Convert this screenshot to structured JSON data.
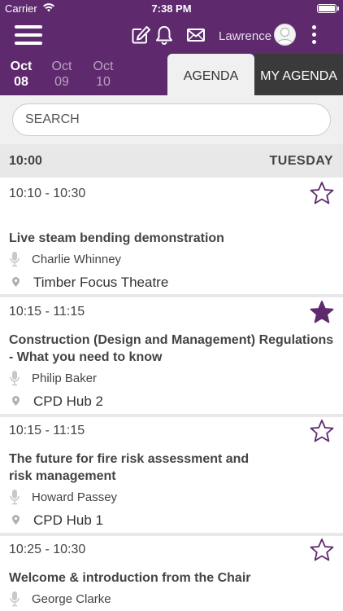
{
  "status_bar": {
    "carrier": "Carrier",
    "time": "7:38 PM"
  },
  "header": {
    "user_name": "Lawrence"
  },
  "dates": [
    {
      "month": "Oct",
      "day": "08",
      "active": true
    },
    {
      "month": "Oct",
      "day": "09",
      "active": false
    },
    {
      "month": "Oct",
      "day": "10",
      "active": false
    }
  ],
  "tabs": {
    "agenda": "AGENDA",
    "my_agenda": "MY AGENDA"
  },
  "search": {
    "placeholder": "SEARCH"
  },
  "day_header": {
    "time": "10:00",
    "day": "TUESDAY"
  },
  "sessions": [
    {
      "time": "10:10 - 10:30",
      "title": "Live steam bending demonstration",
      "speaker": "Charlie Whinney",
      "location": "Timber Focus Theatre",
      "favourited": false
    },
    {
      "time": "10:15 - 11:15",
      "title": "Construction (Design and Management) Regulations - What you need to know",
      "speaker": "Philip Baker",
      "location": "CPD Hub 2",
      "favourited": true
    },
    {
      "time": "10:15 - 11:15",
      "title": "The future for fire risk assessment and risk management",
      "speaker": "Howard Passey",
      "location": "CPD Hub 1",
      "favourited": false
    },
    {
      "time": "10:25 - 10:30",
      "title": "Welcome & introduction from the Chair",
      "speaker": "George Clarke",
      "location": "",
      "favourited": false
    }
  ],
  "colors": {
    "brand": "#5e2a6d",
    "tab_dark": "#3a3a3a",
    "section_bg": "#e8e8e8",
    "star": "#5e2a6d"
  },
  "icons": [
    "menu-icon",
    "edit-icon",
    "bell-icon",
    "mail-icon",
    "avatar-icon",
    "more-vertical-icon",
    "microphone-icon",
    "location-pin-icon",
    "star-outline-icon",
    "star-filled-icon",
    "wifi-icon",
    "battery-icon"
  ]
}
